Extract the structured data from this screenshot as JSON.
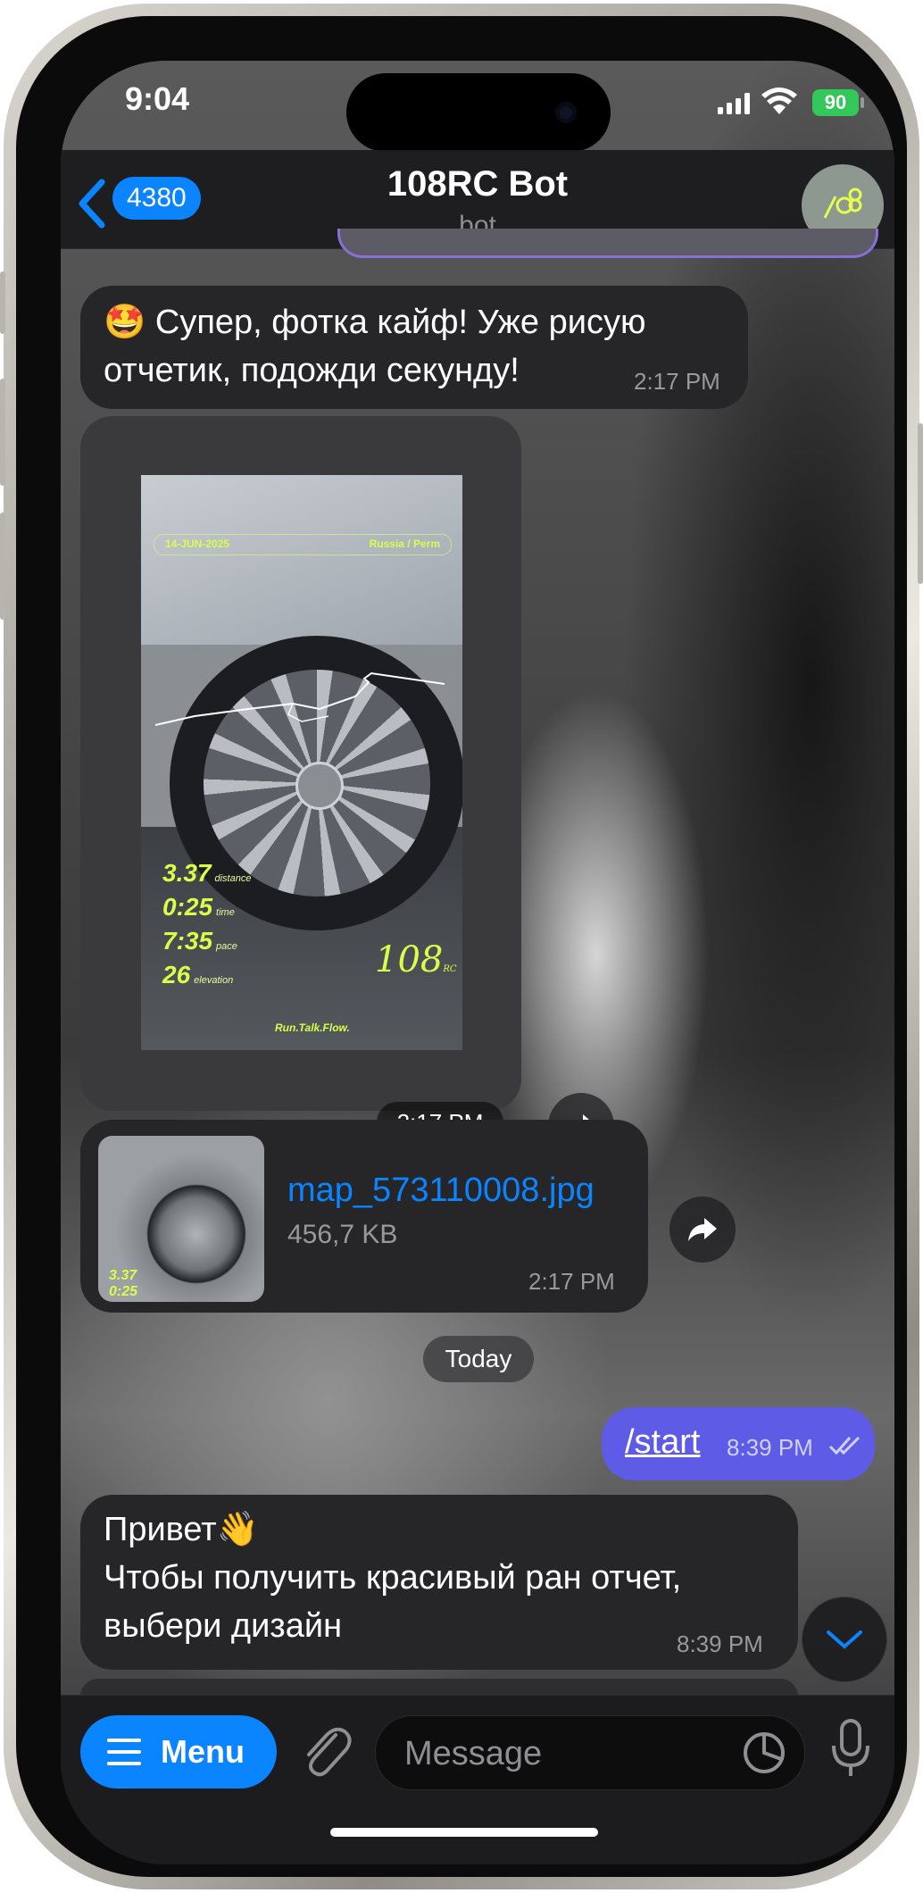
{
  "status_bar": {
    "time": "9:04",
    "battery": "90"
  },
  "header": {
    "back_count": "4380",
    "title": "108RC Bot",
    "subtitle": "bot"
  },
  "messages": {
    "m1": {
      "emoji": "🤩",
      "text": "Супер, фотка кайф! Уже рисую отчетик, подожди секунду!",
      "time": "2:17 PM"
    },
    "photo": {
      "time": "2:17 PM",
      "date": "14-JUN-2025",
      "location": "Russia / Perm",
      "stats": [
        {
          "value": "3.37",
          "label": "distance"
        },
        {
          "value": "0:25",
          "label": "time"
        },
        {
          "value": "7:35",
          "label": "pace"
        },
        {
          "value": "26",
          "label": "elevation"
        }
      ],
      "tagline": "Run.Talk.Flow.",
      "logo": "108",
      "logo_sub": "RC"
    },
    "file": {
      "name": "map_573110008.jpg",
      "size": "456,7 KB",
      "time": "2:17 PM",
      "thumb_line1": "3.37",
      "thumb_line2": "0:25"
    },
    "date_divider": "Today",
    "m2": {
      "text": "/start",
      "time": "8:39 PM"
    },
    "m3": {
      "line1": "Привет👋",
      "line2": "Чтобы получить красивый ран отчет,",
      "line3": "выбери дизайн",
      "time": "8:39 PM"
    }
  },
  "input": {
    "menu_label": "Menu",
    "placeholder": "Message"
  },
  "colors": {
    "accent": "#0a84ff",
    "outgoing_bubble": "#5e5ce6",
    "incoming_bubble": "#262628",
    "highlight": "#d8ff4a"
  }
}
